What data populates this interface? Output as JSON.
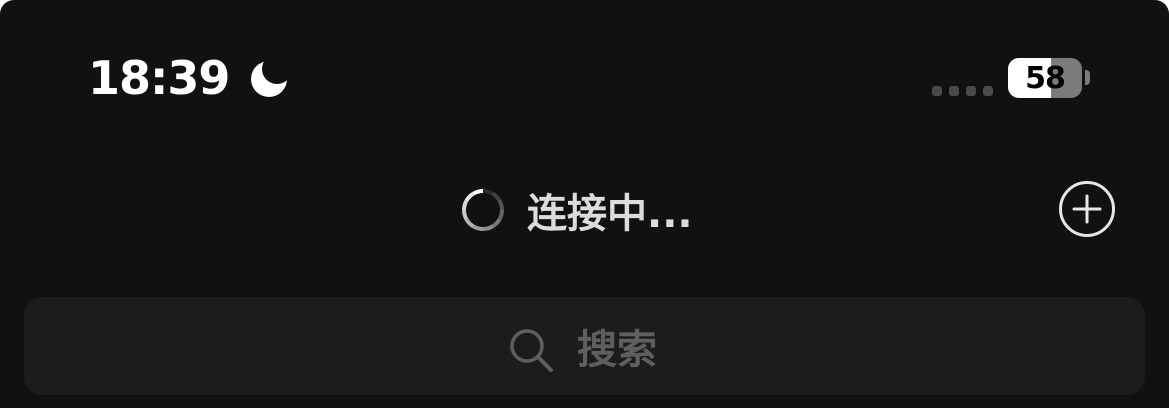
{
  "status_bar": {
    "time": "18:39",
    "focus_icon": "moon-icon",
    "signal_icon": "signal-dots-icon",
    "battery_level": "58",
    "battery_fraction": 0.58
  },
  "nav": {
    "title": "连接中...",
    "spinner_icon": "spinner-icon",
    "add_icon": "plus-circle-icon"
  },
  "search": {
    "placeholder": "搜索",
    "icon": "search-icon"
  },
  "colors": {
    "background": "#111111",
    "search_bg": "#1c1c1c",
    "title_text": "#dcdcdc",
    "placeholder_text": "#5f5f5f",
    "battery_fill": "#ffffff",
    "battery_empty": "#7b7b7b"
  }
}
